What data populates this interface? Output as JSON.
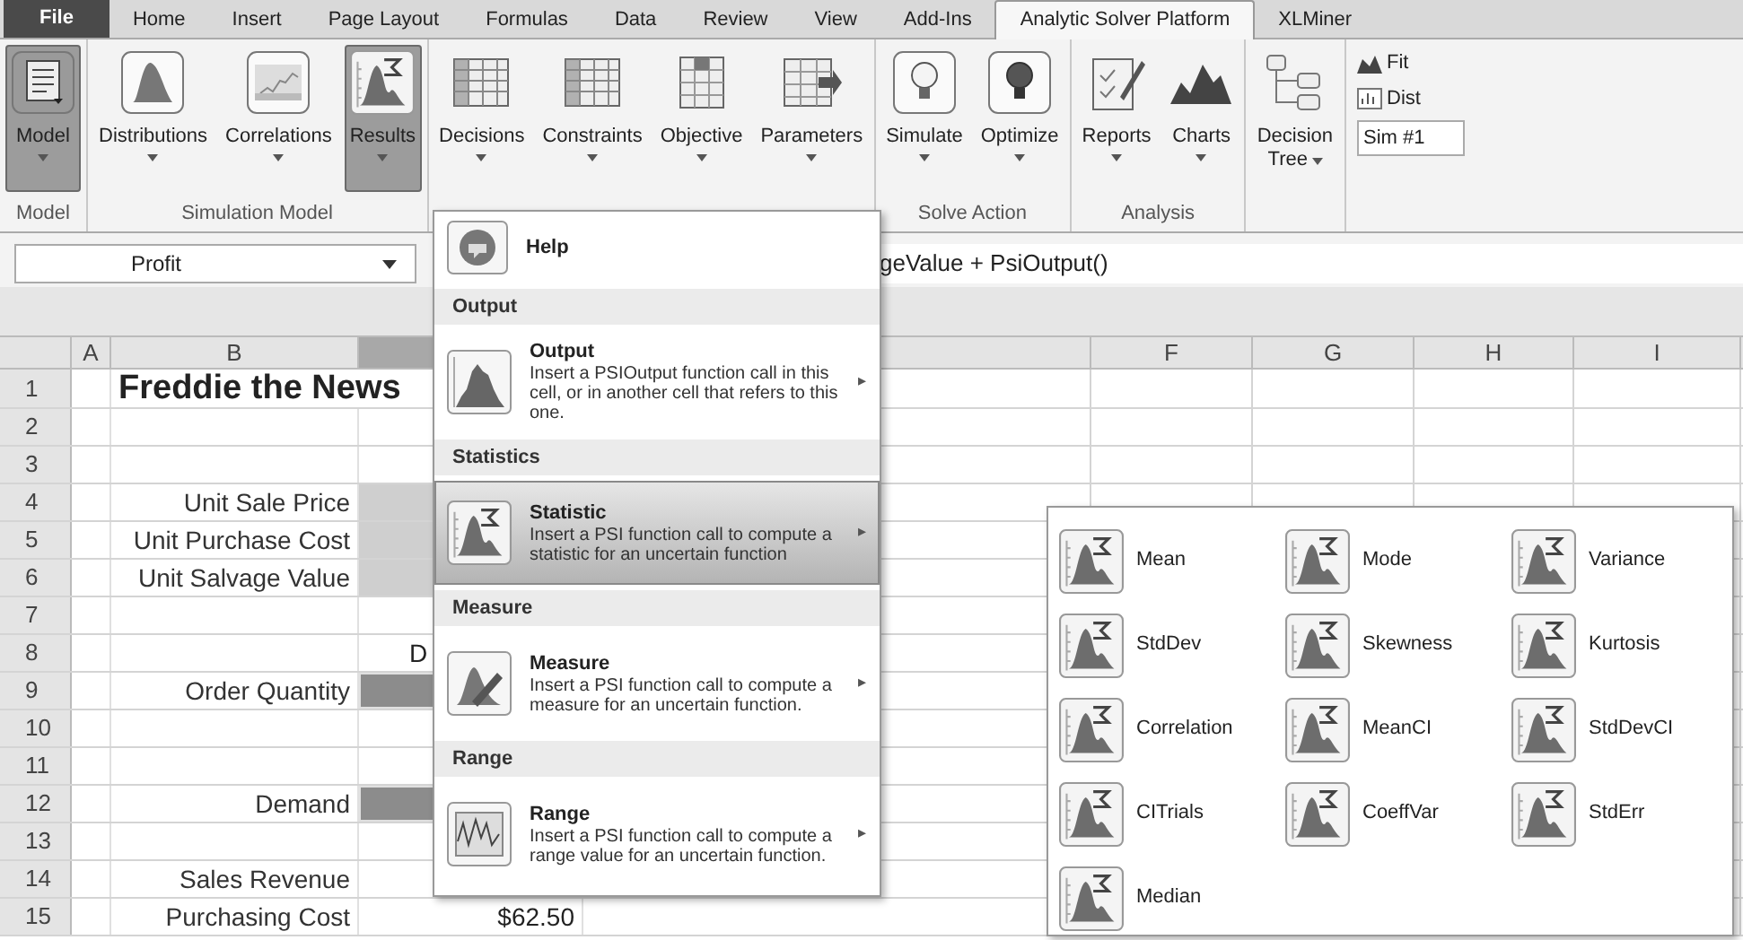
{
  "tabs": [
    {
      "label": "File",
      "kind": "file",
      "selected": false
    },
    {
      "label": "Home",
      "kind": "tab",
      "selected": false
    },
    {
      "label": "Insert",
      "kind": "tab",
      "selected": false
    },
    {
      "label": "Page Layout",
      "kind": "tab",
      "selected": false
    },
    {
      "label": "Formulas",
      "kind": "tab",
      "selected": false
    },
    {
      "label": "Data",
      "kind": "tab",
      "selected": false
    },
    {
      "label": "Review",
      "kind": "tab",
      "selected": false
    },
    {
      "label": "View",
      "kind": "tab",
      "selected": false
    },
    {
      "label": "Add-Ins",
      "kind": "tab",
      "selected": false
    },
    {
      "label": "Analytic Solver Platform",
      "kind": "tab",
      "selected": true
    },
    {
      "label": "XLMiner",
      "kind": "tab",
      "selected": false
    }
  ],
  "ribbon_groups": [
    {
      "label": "Model",
      "buttons": [
        {
          "label": "Model",
          "kind": "model",
          "pressed": true
        }
      ]
    },
    {
      "label": "Simulation Model",
      "buttons": [
        {
          "label": "Distributions",
          "kind": "distribution",
          "pressed": false
        },
        {
          "label": "Correlations",
          "kind": "correlation",
          "pressed": false
        },
        {
          "label": "Results",
          "kind": "results",
          "pressed": true
        }
      ]
    },
    {
      "buttons": [
        {
          "label": "Decisions",
          "kind": "table",
          "pressed": false
        },
        {
          "label": "Constraints",
          "kind": "table",
          "pressed": false
        },
        {
          "label": "Objective",
          "kind": "objective",
          "pressed": false
        },
        {
          "label": "Parameters",
          "kind": "parameters",
          "pressed": false
        }
      ]
    },
    {
      "label": "Solve Action",
      "buttons": [
        {
          "label": "Simulate",
          "kind": "bulb",
          "pressed": false
        },
        {
          "label": "Optimize",
          "kind": "dark-bulb",
          "pressed": false
        }
      ]
    },
    {
      "label": "Analysis",
      "buttons": [
        {
          "label": "Reports",
          "kind": "report",
          "pressed": false
        },
        {
          "label": "Charts",
          "kind": "chart",
          "pressed": false
        }
      ]
    },
    {
      "buttons": [
        {
          "label": "Decision",
          "label2": "Tree",
          "kind": "tree",
          "pressed": false
        }
      ]
    }
  ],
  "ribbon_small": [
    {
      "label": "Fit",
      "kind": "fit"
    },
    {
      "label": "Dist",
      "kind": "dist"
    }
  ],
  "sim_select": {
    "value": "Sim #1"
  },
  "name_box": {
    "value": "Profit"
  },
  "formula": {
    "value": "geValue + PsiOutput()"
  },
  "columns": [
    {
      "label": "A",
      "selected": false
    },
    {
      "label": "B",
      "selected": false
    },
    {
      "selected": true
    },
    {
      "label": "F",
      "selected": false
    },
    {
      "label": "G",
      "selected": false
    },
    {
      "label": "H",
      "selected": false
    },
    {
      "label": "I",
      "selected": false
    }
  ],
  "rows": [
    {
      "number": "1",
      "title": "Freddie the News",
      "kind": "none"
    },
    {
      "number": "2",
      "kind": "none"
    },
    {
      "number": "3",
      "kind": "none"
    },
    {
      "number": "4",
      "label": "Unit Sale Price",
      "kind": "light"
    },
    {
      "number": "5",
      "label": "Unit Purchase Cost",
      "kind": "light"
    },
    {
      "number": "6",
      "label": "Unit Salvage Value",
      "kind": "light"
    },
    {
      "number": "7",
      "kind": "none"
    },
    {
      "number": "8",
      "value": "D",
      "kind": "none"
    },
    {
      "number": "9",
      "label": "Order Quantity",
      "kind": "dark"
    },
    {
      "number": "10",
      "kind": "none"
    },
    {
      "number": "11",
      "kind": "none"
    },
    {
      "number": "12",
      "label": "Demand",
      "kind": "dark"
    },
    {
      "number": "13",
      "kind": "none"
    },
    {
      "number": "14",
      "label": "Sales Revenue",
      "kind": "none"
    },
    {
      "number": "15",
      "label": "Purchasing Cost",
      "value": "$62.50",
      "kind": "none"
    }
  ],
  "menu": [
    {
      "kind": "help",
      "title": "Help",
      "selected": false
    },
    {
      "kind": "section",
      "title": "Output"
    },
    {
      "kind": "output",
      "title": "Output",
      "description": "Insert a PSIOutput function call in this cell, or in another cell that refers to this one.",
      "arrow": "▸",
      "selected": false
    },
    {
      "kind": "section",
      "title": "Statistics"
    },
    {
      "kind": "statistic",
      "title": "Statistic",
      "description": "Insert a PSI function call to compute a statistic for an uncertain function",
      "arrow": "▸",
      "selected": true
    },
    {
      "kind": "section",
      "title": "Measure"
    },
    {
      "kind": "measure",
      "title": "Measure",
      "description": "Insert a PSI function call to compute a measure for an uncertain function.",
      "arrow": "▸",
      "selected": false
    },
    {
      "kind": "section",
      "title": "Range"
    },
    {
      "kind": "range",
      "title": "Range",
      "description": "Insert a PSI function call to compute a range value for an uncertain function.",
      "arrow": "▸",
      "selected": false
    }
  ],
  "submenu": [
    "Mean",
    "Mode",
    "Variance",
    "StdDev",
    "Skewness",
    "Kurtosis",
    "Correlation",
    "MeanCI",
    "StdDevCI",
    "CITrials",
    "CoeffVar",
    "StdErr",
    "Median"
  ]
}
